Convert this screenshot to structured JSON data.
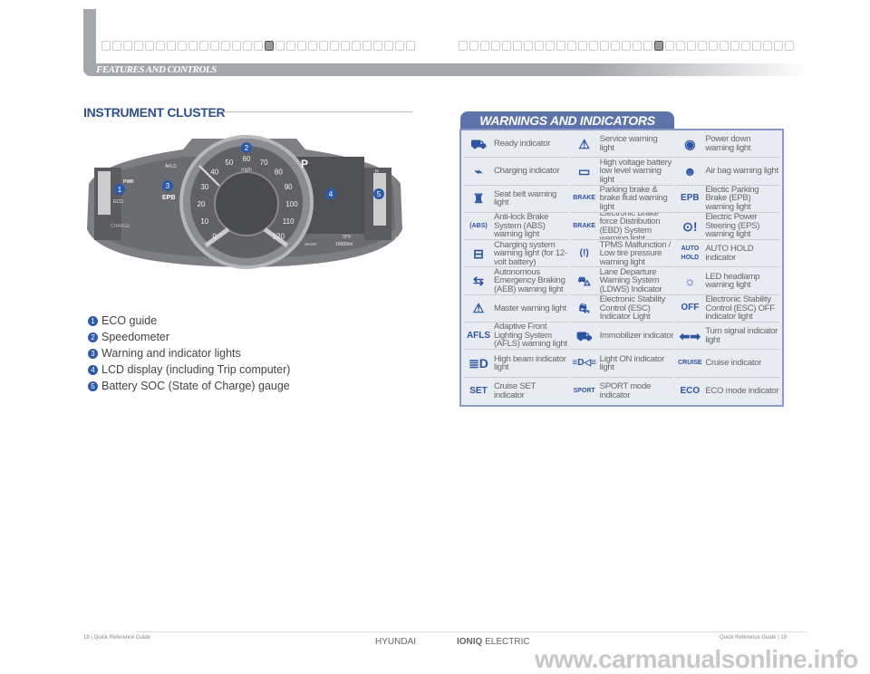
{
  "header": {
    "section": "FEATURES AND CONTROLS"
  },
  "page_title": "INSTRUMENT CLUSTER",
  "cluster": {
    "callouts": [
      "1",
      "2",
      "3",
      "4",
      "5"
    ],
    "speed_ticks": [
      "0",
      "10",
      "20",
      "30",
      "40",
      "50",
      "60",
      "70",
      "80",
      "90",
      "100",
      "110",
      "120"
    ],
    "unit": "mph",
    "gear": "P",
    "left_labels": {
      "pwr": "PWR",
      "eco": "ECO",
      "charge": "CHARGE"
    },
    "right_labels": {
      "h": "H",
      "l": "L"
    },
    "temp": "70°F",
    "odometer": "10000mi",
    "afls": "AFLS",
    "epb": "EPB",
    "sport": "SPORT"
  },
  "legend": [
    {
      "n": "1",
      "text": "ECO guide"
    },
    {
      "n": "2",
      "text": "Speedometer"
    },
    {
      "n": "3",
      "text": "Warning and indicator lights"
    },
    {
      "n": "4",
      "text": "LCD display (including Trip computer)"
    },
    {
      "n": "5",
      "text": "Battery SOC (State of Charge) gauge"
    }
  ],
  "warnings": {
    "title": "WARNINGS AND INDICATORS",
    "accent": "#2c54a0",
    "items": [
      {
        "icon": "car-ready-icon",
        "glyph": "⛟",
        "label": "Ready indicator"
      },
      {
        "icon": "service-ev-warning-icon",
        "glyph": "⚠",
        "label": "Service warning light"
      },
      {
        "icon": "power-down-icon",
        "glyph": "◉",
        "label": "Power down warning light"
      },
      {
        "icon": "charging-plug-icon",
        "glyph": "⌁",
        "label": "Charging indicator"
      },
      {
        "icon": "hv-battery-icon",
        "glyph": "▭",
        "label": "High voltage battery low level warning light"
      },
      {
        "icon": "airbag-icon",
        "glyph": "☻",
        "label": "Air bag warning light"
      },
      {
        "icon": "seat-belt-icon",
        "glyph": "♜",
        "label": "Seat belt warning light"
      },
      {
        "icon": "brake-icon",
        "glyph": "BRAKE",
        "label": "Parking brake & brake fluid warning light"
      },
      {
        "icon": "epb-icon",
        "glyph": "EPB",
        "label": "Electic Parking Brake (EPB) warning light"
      },
      {
        "icon": "abs-icon",
        "glyph": "(ABS)",
        "label": "Anti-lock Brake System (ABS) warning light"
      },
      {
        "icon": "ebd-icon",
        "glyph": "BRAKE",
        "label": "Electronic Brake force Distribution (EBD) System warning light"
      },
      {
        "icon": "eps-icon",
        "glyph": "⊙!",
        "label": "Electric Power Steering (EPS) warning light"
      },
      {
        "icon": "battery-icon",
        "glyph": "⊟",
        "label": "Charging system warning light (for 12-volt battery)"
      },
      {
        "icon": "tpms-icon",
        "glyph": "(!)",
        "label": "TPMS Malfunction / Low tire pressure warning light"
      },
      {
        "icon": "auto-hold-icon",
        "glyph": "AUTO HOLD",
        "label": "AUTO HOLD indicator"
      },
      {
        "icon": "aeb-icon",
        "glyph": "⇆",
        "label": "Autonomous Emergency Braking (AEB) warning light"
      },
      {
        "icon": "lane-departure-icon",
        "glyph": "⛍",
        "label": "Lane Departure Warning System (LDWS) Indicator"
      },
      {
        "icon": "led-headlamp-icon",
        "glyph": "☼",
        "label": "LED headlamp warning light"
      },
      {
        "icon": "master-warning-icon",
        "glyph": "⚠",
        "label": "Master warning light"
      },
      {
        "icon": "esc-icon",
        "glyph": "⛐",
        "label": "Electronic Stability Control (ESC) Indicator Light"
      },
      {
        "icon": "esc-off-icon",
        "glyph": "OFF",
        "label": "Electronic Stability Control (ESC) OFF indicator light"
      },
      {
        "icon": "afls-icon",
        "glyph": "AFLS",
        "label": "Adaptive Front Lighting System (AFLS) warning light"
      },
      {
        "icon": "immobilizer-icon",
        "glyph": "⛟",
        "label": "Immobilizer indicator"
      },
      {
        "icon": "turn-signal-icon",
        "glyph": "⬅➡",
        "label": "Turn signal indicator light"
      },
      {
        "icon": "high-beam-icon",
        "glyph": "≣D",
        "label": "High beam indicator light"
      },
      {
        "icon": "light-on-icon",
        "glyph": "≡D◁≡",
        "label": "Light ON indicator light"
      },
      {
        "icon": "cruise-icon",
        "glyph": "CRUISE",
        "label": "Cruise indicator"
      },
      {
        "icon": "cruise-set-icon",
        "glyph": "SET",
        "label": "Cruise SET indicator"
      },
      {
        "icon": "sport-mode-icon",
        "glyph": "SPORT",
        "label": "SPORT mode indicator"
      },
      {
        "icon": "eco-mode-icon",
        "glyph": "ECO",
        "label": "ECO mode indicator"
      }
    ]
  },
  "footer": {
    "left": "18 | Quick Reference Guide",
    "right": "Quick Reference Guide | 19",
    "brand": "HYUNDAI",
    "model_bold": "IONIQ",
    "model": "ELECTRIC"
  },
  "watermark": "www.carmanualsonline.info"
}
